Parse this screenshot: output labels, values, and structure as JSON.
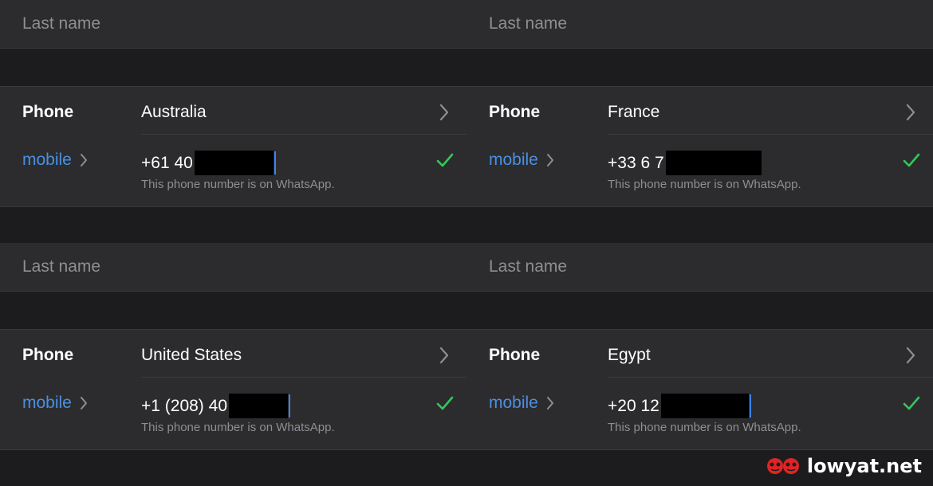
{
  "panels": [
    {
      "last_name_placeholder": "Last name",
      "phone_label": "Phone",
      "country": "Australia",
      "number_label": "mobile",
      "number_prefix": "+61  40",
      "note": "This phone number is on WhatsApp."
    },
    {
      "last_name_placeholder": "Last name",
      "phone_label": "Phone",
      "country": "France",
      "number_label": "mobile",
      "number_prefix": "+33  6 7",
      "note": "This phone number is on WhatsApp."
    },
    {
      "last_name_placeholder": "Last name",
      "phone_label": "Phone",
      "country": "United States",
      "number_label": "mobile",
      "number_prefix": "+1  (208) 40",
      "note": "This phone number is on WhatsApp."
    },
    {
      "last_name_placeholder": "Last name",
      "phone_label": "Phone",
      "country": "Egypt",
      "number_label": "mobile",
      "number_prefix": "+20  12",
      "note": "This phone number is on WhatsApp."
    }
  ],
  "watermark": {
    "text": "lowyat.net",
    "icon": "lowyat-logo-icon"
  },
  "colors": {
    "background": "#1c1c1e",
    "cell": "#2c2c2e",
    "link_blue": "#4a90e2",
    "check_green": "#34c759",
    "secondary_text": "#8e8e93"
  }
}
